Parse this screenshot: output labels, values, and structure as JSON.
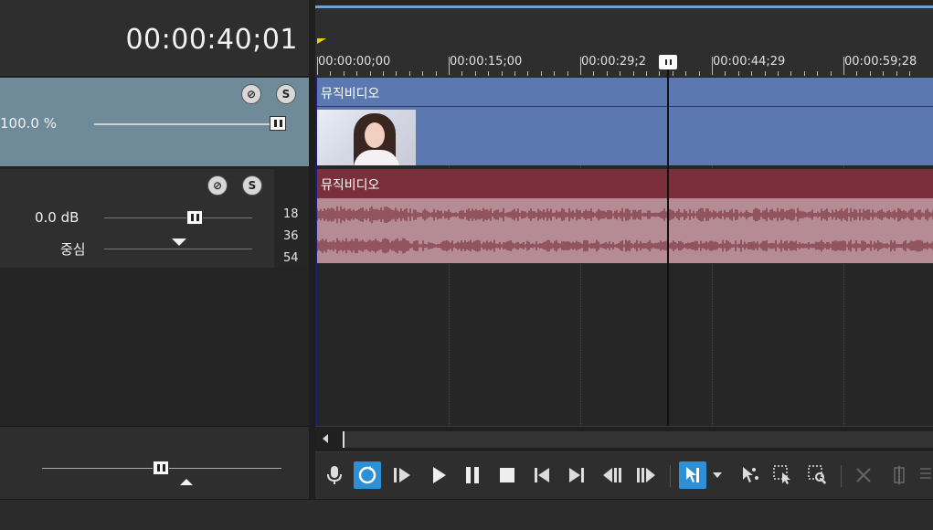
{
  "header": {
    "timecode": "00:00:40;01"
  },
  "video_track_header": {
    "level_value": "100.0 %",
    "mute_icon": "mute-icon",
    "solo_icon": "solo-icon",
    "level_fraction": 0.96
  },
  "audio_track_header": {
    "volume_value": "0.0 dB",
    "pan_label": "중심",
    "volume_fraction": 0.6,
    "pan_fraction": 0.5
  },
  "meter_labels": [
    "18",
    "36",
    "54"
  ],
  "ruler": {
    "labels": [
      "00:00:00;00",
      "00:00:15;00",
      "00:00:29;2",
      "00:00:44;29",
      "00:00:59;28"
    ]
  },
  "tracks": {
    "video_clip_name": "뮤직비디오",
    "audio_clip_name": "뮤직비디오"
  },
  "colors": {
    "video_track": "#5b78b0",
    "audio_title": "#7a2f3b",
    "audio_wave": "#7a2f3b",
    "accent": "#2d8fd6",
    "video_header": "#6f8b99"
  },
  "transport_icons": [
    "record-microphone-icon",
    "loop-playback-icon",
    "play-from-start-icon",
    "play-icon",
    "pause-icon",
    "stop-icon",
    "go-to-start-icon",
    "go-to-end-icon",
    "previous-frame-icon",
    "next-frame-icon",
    "normal-edit-tool-icon",
    "tool-dropdown-icon",
    "envelope-edit-tool-icon",
    "selection-edit-tool-icon",
    "zoom-edit-tool-icon",
    "delete-icon",
    "trim-icon"
  ]
}
